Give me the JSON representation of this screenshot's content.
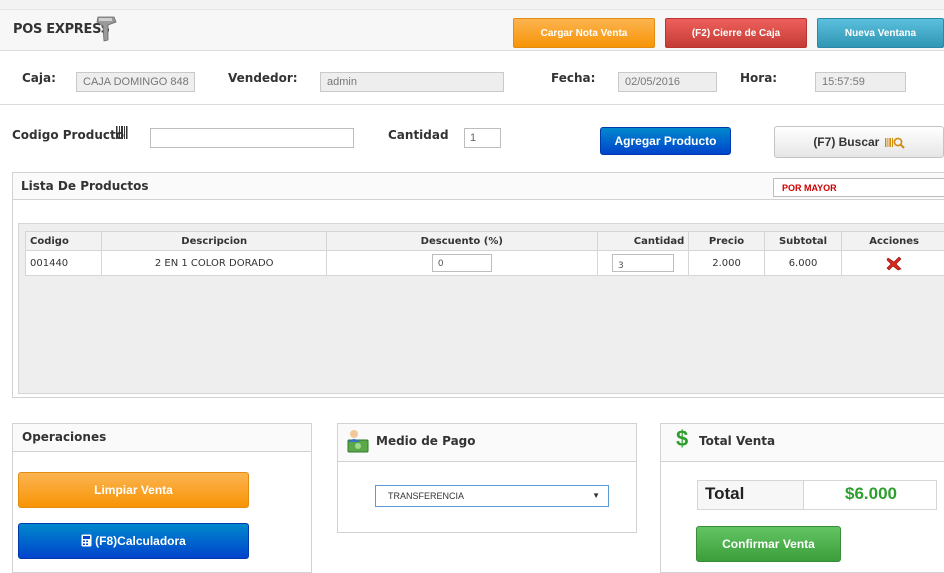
{
  "header": {
    "brand": "POS EXPRESS",
    "buttons": {
      "load_note": "Cargar Nota Venta",
      "close_register": "(F2) Cierre de Caja",
      "new_window": "Nueva Ventana"
    }
  },
  "info": {
    "caja_label": "Caja:",
    "caja_value": "CAJA DOMINGO 848",
    "vendedor_label": "Vendedor:",
    "vendedor_value": "admin",
    "fecha_label": "Fecha:",
    "fecha_value": "02/05/2016",
    "hora_label": "Hora:",
    "hora_value": "15:57:59"
  },
  "entry": {
    "codigo_label": "Codigo Producto",
    "codigo_value": "",
    "cantidad_label": "Cantidad",
    "cantidad_value": "1",
    "add_button": "Agregar Producto",
    "search_button": "(F7) Buscar"
  },
  "products": {
    "title": "Lista De Productos",
    "price_type": "POR MAYOR",
    "columns": [
      "Codigo",
      "Descripcion",
      "Descuento (%)",
      "Cantidad",
      "Precio",
      "Subtotal",
      "Acciones"
    ],
    "rows": [
      {
        "codigo": "001440",
        "descripcion": "2 EN 1 COLOR DORADO",
        "descuento": "0",
        "cantidad": "3",
        "precio": "2.000",
        "subtotal": "6.000"
      }
    ]
  },
  "operations": {
    "title": "Operaciones",
    "clear_button": "Limpiar Venta",
    "calculator_button": "(F8)Calculadora"
  },
  "payment": {
    "title": "Medio de Pago",
    "selected": "TRANSFERENCIA"
  },
  "total": {
    "title": "Total Venta",
    "label": "Total",
    "value": "$6.000",
    "confirm_button": "Confirmar Venta"
  },
  "colors": {
    "orange": "#f89406",
    "red": "#c43c35",
    "teal": "#2f96b4",
    "blue": "#0044cc",
    "green": "#3b9e3b",
    "price_type_text": "#cc0000",
    "total_value": "#2e9e2e"
  }
}
